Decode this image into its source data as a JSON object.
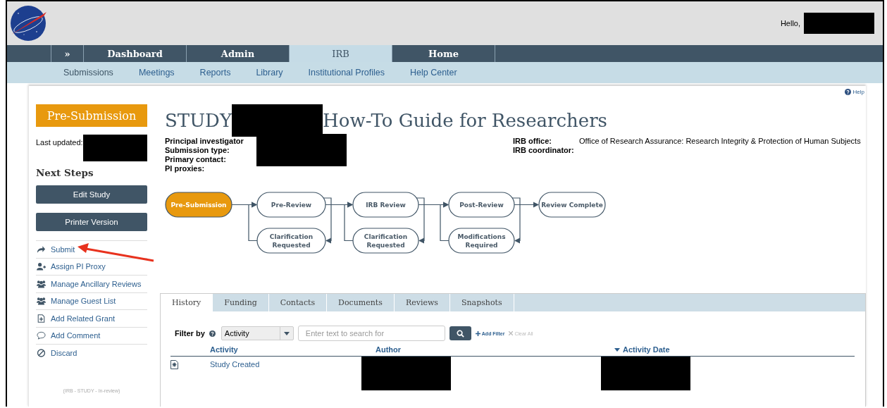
{
  "header": {
    "greeting": "Hello,"
  },
  "nav": {
    "tabs": [
      {
        "label": "»",
        "selected": false
      },
      {
        "label": "Dashboard",
        "selected": false
      },
      {
        "label": "Admin",
        "selected": false
      },
      {
        "label": "IRB",
        "selected": true
      },
      {
        "label": "Home",
        "selected": false
      }
    ],
    "subnav": [
      {
        "label": "Submissions",
        "selected": true
      },
      {
        "label": "Meetings",
        "selected": false
      },
      {
        "label": "Reports",
        "selected": false
      },
      {
        "label": "Library",
        "selected": false
      },
      {
        "label": "Institutional Profiles",
        "selected": false
      },
      {
        "label": "Help Center",
        "selected": false
      }
    ]
  },
  "help": "Help",
  "sidebar": {
    "state": "Pre-Submission",
    "last_updated_label": "Last updated:",
    "next_steps_title": "Next Steps",
    "buttons": [
      "Edit Study",
      "Printer Version"
    ],
    "actions": [
      {
        "label": "Submit",
        "kind": "share"
      },
      {
        "label": "Assign PI Proxy",
        "kind": "user-plus"
      },
      {
        "label": "Manage Ancillary Reviews",
        "kind": "users"
      },
      {
        "label": "Manage Guest List",
        "kind": "users"
      },
      {
        "label": "Add Related Grant",
        "kind": "file-plus"
      },
      {
        "label": "Add Comment",
        "kind": "comment"
      },
      {
        "label": "Discard",
        "kind": "ban"
      }
    ],
    "footer_note": "(IRB - STUDY - In-review)"
  },
  "study": {
    "title_prefix": "STUDY",
    "title_suffix": "How-To Guide for Researchers",
    "fields_left": [
      "Principal investigator",
      "Submission type:",
      "Primary contact:",
      "PI proxies:"
    ],
    "fields_right": [
      {
        "label": "IRB office:",
        "value": "Office of Research Assurance: Research Integrity & Protection of Human Subjects"
      },
      {
        "label": "IRB coordinator:"
      }
    ]
  },
  "workflow": {
    "nodes": [
      {
        "label": "Pre-Submission",
        "selected": true
      },
      {
        "label": "Pre-Review",
        "selected": false
      },
      {
        "label": "Clarification Requested",
        "selected": false
      },
      {
        "label": "IRB Review",
        "selected": false
      },
      {
        "label": "Clarification Requested",
        "selected": false
      },
      {
        "label": "Post-Review",
        "selected": false
      },
      {
        "label": "Modifications Required",
        "selected": false
      },
      {
        "label": "Review Complete",
        "selected": false
      }
    ]
  },
  "activity_tabs": [
    {
      "label": "History",
      "selected": true
    },
    {
      "label": "Funding",
      "selected": false
    },
    {
      "label": "Contacts",
      "selected": false
    },
    {
      "label": "Documents",
      "selected": false
    },
    {
      "label": "Reviews",
      "selected": false
    },
    {
      "label": "Snapshots",
      "selected": false
    }
  ],
  "filter": {
    "label": "Filter by",
    "select": "Activity",
    "placeholder": "Enter text to search for",
    "add_filter": "Add Filter",
    "clear_all": "Clear All"
  },
  "table": {
    "columns": [
      {
        "label": "Activity",
        "sorted": false
      },
      {
        "label": "Author",
        "sorted": false
      },
      {
        "label": "Activity Date",
        "sorted": true
      }
    ],
    "rows": [
      {
        "activity": "Study Created"
      }
    ]
  }
}
